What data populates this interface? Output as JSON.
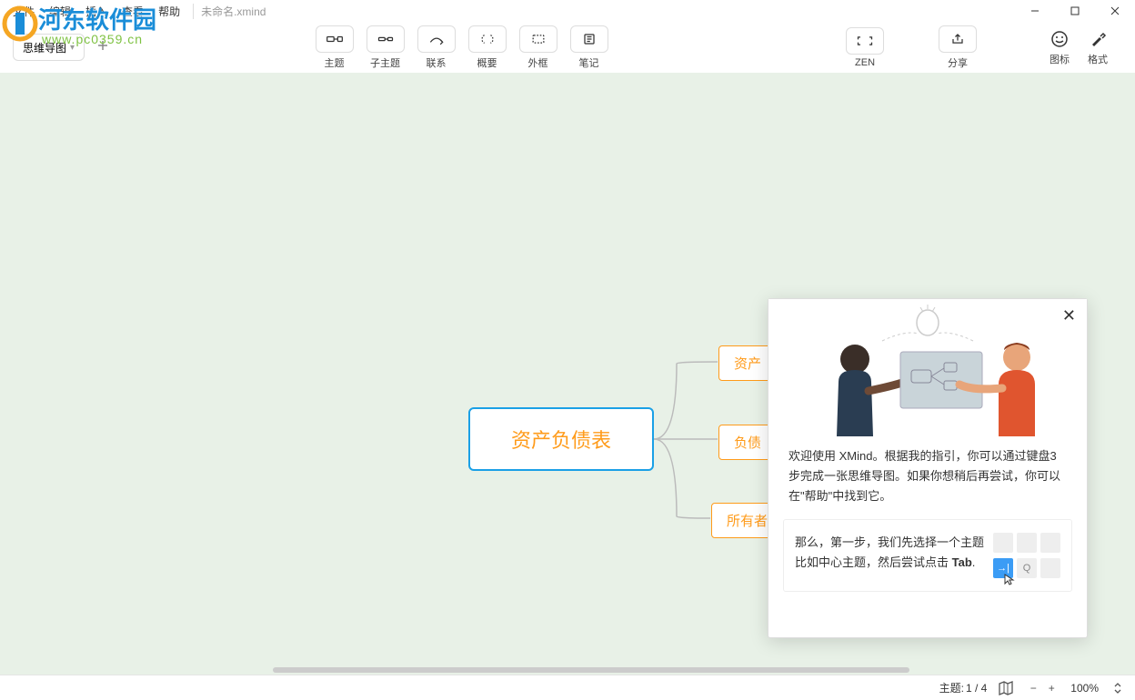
{
  "menubar": {
    "file": "文件",
    "edit": "编辑",
    "insert": "插入",
    "view": "查看",
    "help": "帮助",
    "filename": "未命名.xmind"
  },
  "tab": {
    "label": "思维导图"
  },
  "toolbar": {
    "topic": "主题",
    "subtopic": "子主题",
    "relation": "联系",
    "summary": "概要",
    "boundary": "外框",
    "notes": "笔记",
    "zen": "ZEN",
    "share": "分享",
    "icon_label": "图标",
    "format_label": "格式"
  },
  "mindmap": {
    "central": "资产负债表",
    "child1": "资产",
    "child2": "负债",
    "child3": "所有者"
  },
  "popup": {
    "intro": "欢迎使用 XMind。根据我的指引，你可以通过键盘3步完成一张思维导图。如果你想稍后再尝试，你可以在\"帮助\"中找到它。",
    "step_prefix": "那么，第一步，我们先选择一个主题比如中心主题，然后尝试点击 ",
    "step_key": "Tab",
    "step_suffix": ".",
    "q_key": "Q",
    "tab_glyph": "→|"
  },
  "statusbar": {
    "topic_count_label": "主题:",
    "topic_count": "1 / 4",
    "zoom": "100%"
  },
  "watermark": {
    "title": "河东软件园",
    "sub": "www.pc0359.cn"
  }
}
